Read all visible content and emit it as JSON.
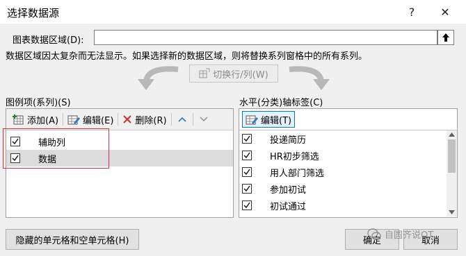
{
  "window": {
    "title": "选择数据源",
    "help_glyph": "?",
    "close_glyph": "✕"
  },
  "data_range": {
    "label": "图表数据区域(D):",
    "value": ""
  },
  "message": "数据区域因太复杂而无法显示。如果选择新的数据区域，则将替换系列窗格中的所有系列。",
  "switch_button": "切换行/列(W)",
  "legend": {
    "heading": "图例项(系列)(S)",
    "add": "添加(A)",
    "edit": "编辑(E)",
    "delete": "删除(R)",
    "items": [
      {
        "label": "辅助列",
        "checked": true
      },
      {
        "label": "数据",
        "checked": true
      }
    ]
  },
  "axis": {
    "heading": "水平(分类)轴标签(C)",
    "edit": "编辑(T)",
    "items": [
      {
        "label": "投递简历",
        "checked": true
      },
      {
        "label": "HR初步筛选",
        "checked": true
      },
      {
        "label": "用人部门筛选",
        "checked": true
      },
      {
        "label": "参加初试",
        "checked": true
      },
      {
        "label": "初试通过",
        "checked": true
      }
    ]
  },
  "footer": {
    "hidden_cells": "隐藏的单元格和空单元格(H)",
    "ok": "确定",
    "cancel": "取消",
    "watermark": "自圆齐说OT"
  },
  "colors": {
    "accent": "#0078d7",
    "highlight_border": "#e03030",
    "selected_row": "#dcdcdc"
  }
}
